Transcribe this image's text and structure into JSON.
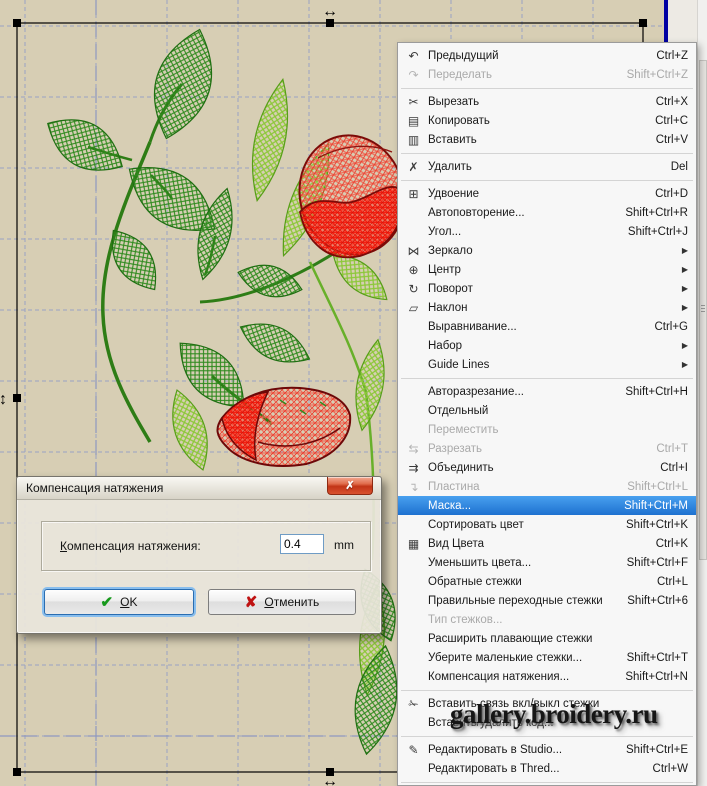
{
  "watermark": {
    "text": "gallery.broidery.ru"
  },
  "icons": {
    "undo": "↶",
    "redo": "↷",
    "cut": "✂",
    "copy": "▤",
    "paste": "▥",
    "delete": "✗",
    "duplicate": "⊞",
    "mirror": "⋈",
    "center": "⊕",
    "rotate": "↻",
    "skew": "▱",
    "split": "⇆",
    "join": "⇉",
    "plate": "↴",
    "color-view": "▦",
    "stitch-link": "✁",
    "edit-studio": "✎",
    "close": "✗",
    "check": "✔",
    "cancel_x": "✘",
    "submenu_arrow": "▶",
    "h_resize": "↔",
    "v_resize": "↕"
  },
  "colors": {
    "canvas_bg": "#d7ceb4",
    "grid": "#9aa3c4",
    "hoop_line": "#0000a2",
    "menu_highlight": "#1e71d0",
    "thread_dark_green": "#2e8a1d",
    "thread_light_green": "#8cc838",
    "thread_red": "#f52a1a",
    "thread_red_light": "#f4796a",
    "thread_red_outline": "#7c0b08"
  },
  "menu": {
    "items": [
      {
        "type": "item",
        "label": "Предыдущий",
        "shortcut": "Ctrl+Z",
        "icon": "undo"
      },
      {
        "type": "item",
        "label": "Переделать",
        "shortcut": "Shift+Ctrl+Z",
        "icon": "redo",
        "disabled": true
      },
      {
        "type": "separator"
      },
      {
        "type": "item",
        "label": "Вырезать",
        "shortcut": "Ctrl+X",
        "icon": "cut"
      },
      {
        "type": "item",
        "label": "Копировать",
        "shortcut": "Ctrl+C",
        "icon": "copy"
      },
      {
        "type": "item",
        "label": "Вставить",
        "shortcut": "Ctrl+V",
        "icon": "paste"
      },
      {
        "type": "separator"
      },
      {
        "type": "item",
        "label": "Удалить",
        "shortcut": "Del",
        "icon": "delete"
      },
      {
        "type": "separator"
      },
      {
        "type": "item",
        "label": "Удвоение",
        "shortcut": "Ctrl+D",
        "icon": "duplicate"
      },
      {
        "type": "item",
        "label": "Автоповторение...",
        "shortcut": "Shift+Ctrl+R"
      },
      {
        "type": "item",
        "label": "Угол...",
        "shortcut": "Shift+Ctrl+J"
      },
      {
        "type": "item",
        "label": "Зеркало",
        "submenu": true,
        "icon": "mirror"
      },
      {
        "type": "item",
        "label": "Центр",
        "submenu": true,
        "icon": "center"
      },
      {
        "type": "item",
        "label": "Поворот",
        "submenu": true,
        "icon": "rotate"
      },
      {
        "type": "item",
        "label": "Наклон",
        "submenu": true,
        "icon": "skew"
      },
      {
        "type": "item",
        "label": "Выравнивание...",
        "shortcut": "Ctrl+G"
      },
      {
        "type": "item",
        "label": "Набор",
        "submenu": true
      },
      {
        "type": "item",
        "label": "Guide Lines",
        "submenu": true
      },
      {
        "type": "separator"
      },
      {
        "type": "item",
        "label": "Авторазрезание...",
        "shortcut": "Shift+Ctrl+H"
      },
      {
        "type": "item",
        "label": "Отдельный"
      },
      {
        "type": "item",
        "label": "Переместить",
        "disabled": true
      },
      {
        "type": "item",
        "label": "Разрезать",
        "shortcut": "Ctrl+T",
        "icon": "split",
        "disabled": true
      },
      {
        "type": "item",
        "label": "Объединить",
        "shortcut": "Ctrl+I",
        "icon": "join"
      },
      {
        "type": "item",
        "label": "Пластина",
        "shortcut": "Shift+Ctrl+L",
        "icon": "plate",
        "disabled": true
      },
      {
        "type": "item",
        "label": "Маска...",
        "shortcut": "Shift+Ctrl+M",
        "highlighted": true
      },
      {
        "type": "item",
        "label": "Сортировать цвет",
        "shortcut": "Shift+Ctrl+K"
      },
      {
        "type": "item",
        "label": "Вид Цвета",
        "shortcut": "Ctrl+K",
        "icon": "color-view"
      },
      {
        "type": "item",
        "label": "Уменьшить цвета...",
        "shortcut": "Shift+Ctrl+F"
      },
      {
        "type": "item",
        "label": "Обратные стежки",
        "shortcut": "Ctrl+L"
      },
      {
        "type": "item",
        "label": "Правильные переходные стежки",
        "shortcut": "Shift+Ctrl+6"
      },
      {
        "type": "item",
        "label": "Тип стежков...",
        "disabled": true
      },
      {
        "type": "item",
        "label": "Расширить плавающие стежки"
      },
      {
        "type": "item",
        "label": "Уберите маленькие стежки...",
        "shortcut": "Shift+Ctrl+T"
      },
      {
        "type": "item",
        "label": "Компенсация натяжения...",
        "shortcut": "Shift+Ctrl+N"
      },
      {
        "type": "separator"
      },
      {
        "type": "item",
        "label": "Вставить связь вкл/выкл стежки",
        "icon": "stitch-link"
      },
      {
        "type": "item",
        "label": "Вставить/удалить код..."
      },
      {
        "type": "separator"
      },
      {
        "type": "item",
        "label": "Редактировать в Studio...",
        "shortcut": "Shift+Ctrl+E",
        "icon": "edit-studio"
      },
      {
        "type": "item",
        "label": "Редактировать в Thred...",
        "shortcut": "Ctrl+W"
      },
      {
        "type": "separator"
      }
    ]
  },
  "dialog": {
    "title": "Компенсация натяжения",
    "field_label": "Компенсация натяжения:",
    "value": "0.4",
    "unit": "mm",
    "ok_label": "OK",
    "cancel_label": "Отменить"
  }
}
